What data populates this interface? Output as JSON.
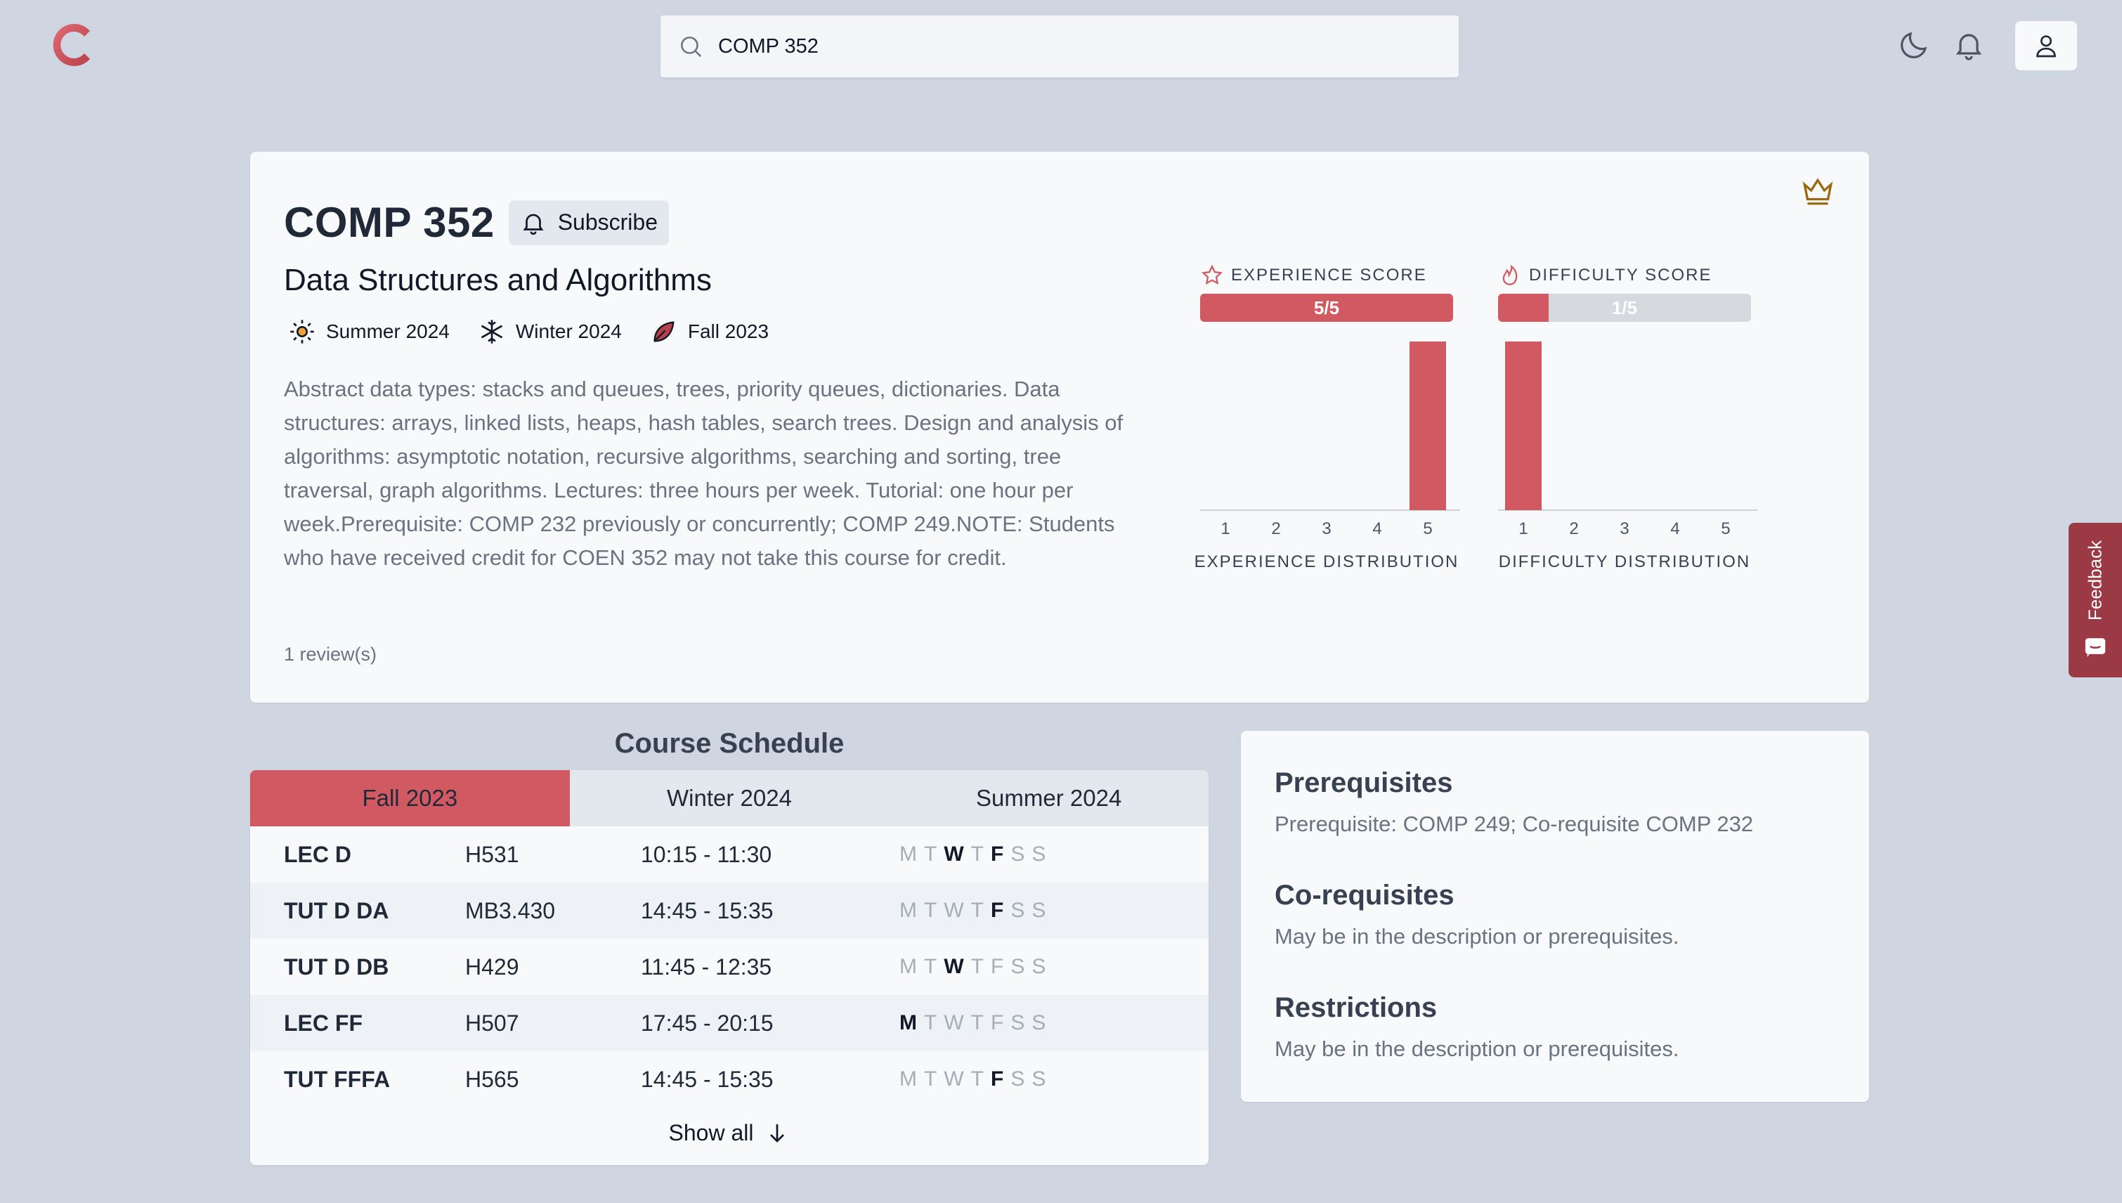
{
  "header": {
    "search_value": "COMP 352"
  },
  "course": {
    "code": "COMP 352",
    "subscribe_label": "Subscribe",
    "name": "Data Structures and Algorithms",
    "terms": [
      {
        "label": "Summer 2024",
        "icon": "sun-icon"
      },
      {
        "label": "Winter 2024",
        "icon": "snowflake-icon"
      },
      {
        "label": "Fall 2023",
        "icon": "leaf-icon"
      }
    ],
    "description": "Abstract data types: stacks and queues, trees, priority queues, dictionaries. Data structures: arrays, linked lists, heaps, hash tables, search trees. Design and analysis of algorithms: asymptotic notation, recursive algorithms, searching and sorting, tree traversal, graph algorithms. Lectures: three hours per week. Tutorial: one hour per week.Prerequisite: COMP 232 previously or concurrently; COMP 249.NOTE: Students who have received credit for COEN 352 may not take this course for credit.",
    "reviews": "1 review(s)"
  },
  "scores": {
    "experience": {
      "label": "EXPERIENCE SCORE",
      "value_text": "5/5",
      "fraction": 1.0
    },
    "difficulty": {
      "label": "DIFFICULTY SCORE",
      "value_text": "1/5",
      "fraction": 0.2
    }
  },
  "chart_data": [
    {
      "type": "bar",
      "title": "EXPERIENCE DISTRIBUTION",
      "categories": [
        "1",
        "2",
        "3",
        "4",
        "5"
      ],
      "values": [
        0,
        0,
        0,
        0,
        1
      ]
    },
    {
      "type": "bar",
      "title": "DIFFICULTY DISTRIBUTION",
      "categories": [
        "1",
        "2",
        "3",
        "4",
        "5"
      ],
      "values": [
        1,
        0,
        0,
        0,
        0
      ]
    }
  ],
  "schedule": {
    "title": "Course Schedule",
    "tabs": [
      "Fall 2023",
      "Winter 2024",
      "Summer 2024"
    ],
    "active_tab": 0,
    "day_letters": [
      "M",
      "T",
      "W",
      "T",
      "F",
      "S",
      "S"
    ],
    "rows": [
      {
        "section": "LEC D",
        "room": "H531",
        "time": "10:15 - 11:30",
        "days": [
          0,
          0,
          1,
          0,
          1,
          0,
          0
        ]
      },
      {
        "section": "TUT D DA",
        "room": "MB3.430",
        "time": "14:45 - 15:35",
        "days": [
          0,
          0,
          0,
          0,
          1,
          0,
          0
        ]
      },
      {
        "section": "TUT D DB",
        "room": "H429",
        "time": "11:45 - 12:35",
        "days": [
          0,
          0,
          1,
          0,
          0,
          0,
          0
        ]
      },
      {
        "section": "LEC FF",
        "room": "H507",
        "time": "17:45 - 20:15",
        "days": [
          1,
          0,
          0,
          0,
          0,
          0,
          0
        ]
      },
      {
        "section": "TUT FFFA",
        "room": "H565",
        "time": "14:45 - 15:35",
        "days": [
          0,
          0,
          0,
          0,
          1,
          0,
          0
        ]
      }
    ],
    "show_all_label": "Show all"
  },
  "requisites": {
    "prereq_title": "Prerequisites",
    "prereq_text": "Prerequisite: COMP 249; Co-requisite COMP 232",
    "coreq_title": "Co-requisites",
    "coreq_text": "May be in the description or prerequisites.",
    "restrict_title": "Restrictions",
    "restrict_text": "May be in the description or prerequisites."
  },
  "feedback_label": "Feedback",
  "colors": {
    "accent": "#d15a62",
    "background": "#cfd6e1",
    "card": "#f8f9fb",
    "feedback": "#9b3a45",
    "crown": "#9a6a12"
  }
}
